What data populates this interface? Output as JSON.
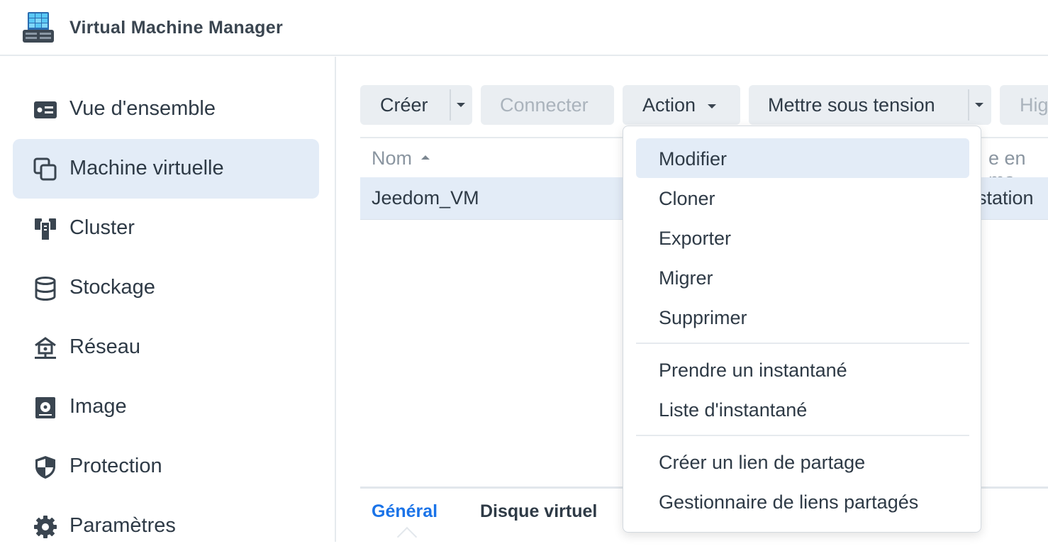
{
  "app": {
    "title": "Virtual Machine Manager",
    "logo_icon": "vmm-logo-icon"
  },
  "sidebar": {
    "items": [
      {
        "label": "Vue d'ensemble",
        "icon": "overview-icon",
        "active": false
      },
      {
        "label": "Machine virtuelle",
        "icon": "virtual-machine-icon",
        "active": true
      },
      {
        "label": "Cluster",
        "icon": "cluster-icon",
        "active": false
      },
      {
        "label": "Stockage",
        "icon": "storage-icon",
        "active": false
      },
      {
        "label": "Réseau",
        "icon": "network-icon",
        "active": false
      },
      {
        "label": "Image",
        "icon": "image-icon",
        "active": false
      },
      {
        "label": "Protection",
        "icon": "shield-icon",
        "active": false
      },
      {
        "label": "Paramètres",
        "icon": "gear-icon",
        "active": false
      }
    ]
  },
  "toolbar": {
    "create_label": "Créer",
    "connect_label": "Connecter",
    "action_label": "Action",
    "power_on_label": "Mettre sous tension",
    "truncated_label": "Hig"
  },
  "grid": {
    "columns": [
      "Nom",
      "e en ma"
    ],
    "rows": [
      {
        "name": "Jeedom_VM",
        "truncated": "station"
      }
    ]
  },
  "details": {
    "tabs": [
      "Général",
      "Disque virtuel"
    ]
  },
  "action_menu": {
    "items": [
      "Modifier",
      "Cloner",
      "Exporter",
      "Migrer",
      "Supprimer",
      "Prendre un instantané",
      "Liste d'instantané",
      "Créer un lien de partage",
      "Gestionnaire de liens partagés"
    ]
  },
  "colors": {
    "accent": "#1a73e8",
    "selection": "#e3ecf7",
    "button": "#eaeef2",
    "icon": "#3a4550"
  }
}
